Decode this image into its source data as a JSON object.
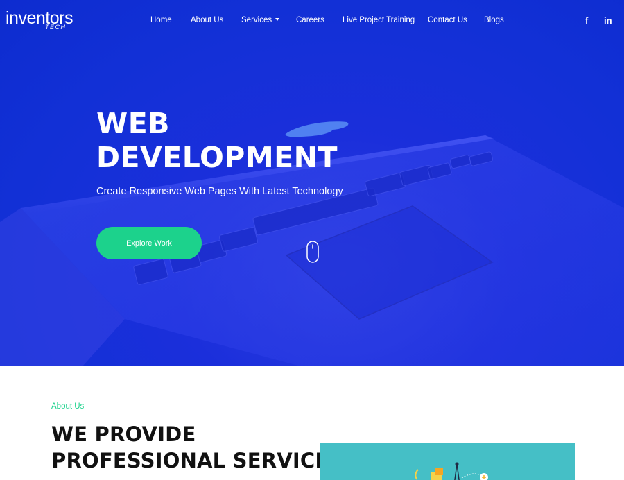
{
  "brand": {
    "name": "inventors",
    "sub": "TECH"
  },
  "nav": {
    "items": [
      {
        "label": "Home"
      },
      {
        "label": "About Us"
      },
      {
        "label": "Services",
        "has_dropdown": true
      },
      {
        "label": "Careers"
      },
      {
        "label": "Live Project Training"
      },
      {
        "label": "Contact Us"
      },
      {
        "label": "Blogs"
      }
    ],
    "social": [
      {
        "icon": "facebook-icon",
        "glyph": "f"
      },
      {
        "icon": "linkedin-icon",
        "glyph": "in"
      }
    ]
  },
  "hero": {
    "title_line1": "WEB",
    "title_line2": "DEVELOPMENT",
    "subtitle": "Create Responsive Web Pages With Latest Technology",
    "cta_label": "Explore Work"
  },
  "about": {
    "label": "About Us",
    "heading_line1": "WE PROVIDE",
    "heading_line2": "PROFESSIONAL SERVICES"
  },
  "colors": {
    "hero_bg": "#1230d6",
    "accent": "#1cd28c",
    "image_bg": "#45bfc6"
  }
}
